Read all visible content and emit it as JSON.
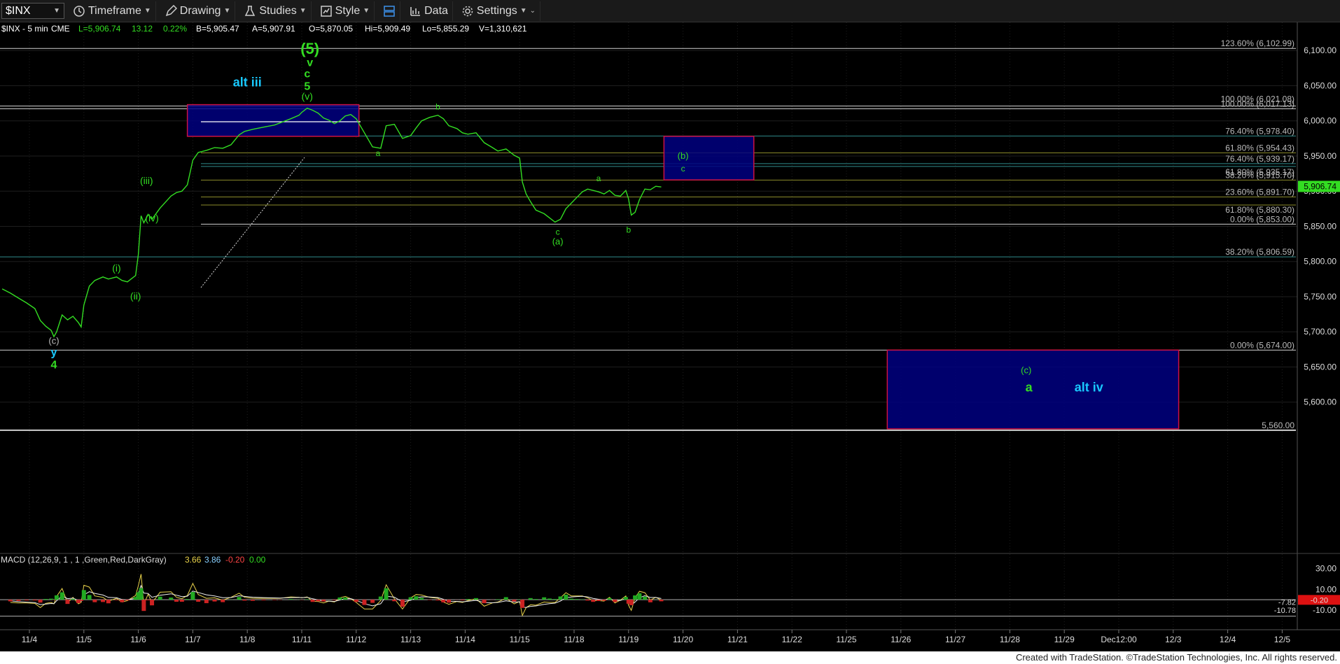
{
  "toolbar": {
    "symbol": "$INX",
    "timeframe": "Timeframe",
    "drawing": "Drawing",
    "studies": "Studies",
    "style": "Style",
    "data": "Data",
    "settings": "Settings"
  },
  "header": {
    "symbol_desc": "$INX - 5 min",
    "exchange": "CME",
    "last": "L=5,906.74",
    "change": "13.12",
    "change_pct": "0.22%",
    "bid": "B=5,905.47",
    "ask": "A=5,907.91",
    "open": "O=5,870.05",
    "high": "Hi=5,909.49",
    "low": "Lo=5,855.29",
    "volume": "V=1,310,621"
  },
  "macd_header": {
    "label": "MACD (12,26,9, 1 , 1 ,Green,Red,DarkGray)",
    "v1": "3.66",
    "v2": "3.86",
    "v3": "-0.20",
    "v4": "0.00"
  },
  "footer": "Created with TradeStation. ©TradeStation Technologies, Inc. All rights reserved.",
  "colors": {
    "price": "#33dd22",
    "label_green": "#33dd22",
    "label_cyan": "#19c9ff",
    "fib_line": "#2f8a8a",
    "box_fill": "#000080",
    "box_border": "#cc1144"
  },
  "chart_data": {
    "type": "line",
    "title": "$INX - 5 min",
    "ylim": [
      5540,
      6140
    ],
    "y_ticks": [
      6100,
      6050,
      6000,
      5950,
      5900,
      5850,
      5800,
      5750,
      5700,
      5650,
      5600
    ],
    "y_tick_labels": [
      "6,100.00",
      "6,050.00",
      "6,000.00",
      "5,950.00",
      "5,900.00",
      "5,850.00",
      "5,800.00",
      "5,750.00",
      "5,700.00",
      "5,650.00",
      "5,600.00"
    ],
    "x_ticks": [
      "11/4",
      "11/5",
      "11/6",
      "11/7",
      "11/8",
      "11/11",
      "11/12",
      "11/13",
      "11/14",
      "11/15",
      "11/18",
      "11/19",
      "11/20",
      "11/21",
      "11/22",
      "11/25",
      "11/26",
      "11/27",
      "11/28",
      "11/29",
      "Dec12:00",
      "12/3",
      "12/4",
      "12/5"
    ],
    "last_price_label": "5,906.74",
    "series": [
      {
        "values": [
          [
            -0.5,
            5761
          ],
          [
            -0.35,
            5755
          ],
          [
            -0.2,
            5748
          ],
          [
            -0.05,
            5741
          ],
          [
            0.1,
            5733
          ],
          [
            0.2,
            5716
          ],
          [
            0.3,
            5708
          ],
          [
            0.4,
            5702
          ],
          [
            0.45,
            5693
          ],
          [
            0.5,
            5700
          ],
          [
            0.6,
            5724
          ],
          [
            0.7,
            5717
          ],
          [
            0.8,
            5722
          ],
          [
            0.9,
            5713
          ],
          [
            0.95,
            5707
          ],
          [
            1.0,
            5738
          ],
          [
            1.1,
            5765
          ],
          [
            1.2,
            5773
          ],
          [
            1.35,
            5778
          ],
          [
            1.45,
            5775
          ],
          [
            1.6,
            5778
          ],
          [
            1.7,
            5773
          ],
          [
            1.8,
            5771
          ],
          [
            1.95,
            5780
          ],
          [
            2.0,
            5810
          ],
          [
            2.05,
            5865
          ],
          [
            2.1,
            5855
          ],
          [
            2.18,
            5867
          ],
          [
            2.25,
            5860
          ],
          [
            2.4,
            5876
          ],
          [
            2.6,
            5893
          ],
          [
            2.7,
            5898
          ],
          [
            2.8,
            5900
          ],
          [
            2.9,
            5909
          ],
          [
            3.0,
            5944
          ],
          [
            3.1,
            5955
          ],
          [
            3.25,
            5958
          ],
          [
            3.4,
            5962
          ],
          [
            3.55,
            5961
          ],
          [
            3.7,
            5966
          ],
          [
            3.85,
            5980
          ],
          [
            3.95,
            5985
          ],
          [
            4.1,
            5988
          ],
          [
            4.3,
            5991
          ],
          [
            4.5,
            5994
          ],
          [
            4.6,
            5997
          ],
          [
            4.8,
            6003
          ],
          [
            4.95,
            6008
          ],
          [
            5.0,
            6012
          ],
          [
            5.1,
            6018
          ],
          [
            5.2,
            6015
          ],
          [
            5.3,
            6011
          ],
          [
            5.4,
            6004
          ],
          [
            5.5,
            6001
          ],
          [
            5.6,
            5996
          ],
          [
            5.7,
            6000
          ],
          [
            5.8,
            6007
          ],
          [
            5.9,
            6009
          ],
          [
            6.0,
            6003
          ],
          [
            6.15,
            5983
          ],
          [
            6.3,
            5963
          ],
          [
            6.45,
            5961
          ],
          [
            6.55,
            5993
          ],
          [
            6.7,
            5995
          ],
          [
            6.85,
            5975
          ],
          [
            7.0,
            5979
          ],
          [
            7.1,
            5990
          ],
          [
            7.2,
            6000
          ],
          [
            7.35,
            6005
          ],
          [
            7.5,
            6008
          ],
          [
            7.6,
            6003
          ],
          [
            7.7,
            5993
          ],
          [
            7.85,
            5989
          ],
          [
            7.95,
            5983
          ],
          [
            8.05,
            5981
          ],
          [
            8.2,
            5983
          ],
          [
            8.35,
            5969
          ],
          [
            8.5,
            5962
          ],
          [
            8.6,
            5957
          ],
          [
            8.75,
            5960
          ],
          [
            8.9,
            5951
          ],
          [
            9.0,
            5947
          ],
          [
            9.05,
            5913
          ],
          [
            9.12,
            5896
          ],
          [
            9.2,
            5885
          ],
          [
            9.3,
            5873
          ],
          [
            9.45,
            5868
          ],
          [
            9.55,
            5862
          ],
          [
            9.65,
            5856
          ],
          [
            9.75,
            5860
          ],
          [
            9.85,
            5875
          ],
          [
            9.95,
            5883
          ],
          [
            10.05,
            5891
          ],
          [
            10.15,
            5899
          ],
          [
            10.25,
            5903
          ],
          [
            10.35,
            5901
          ],
          [
            10.45,
            5899
          ],
          [
            10.55,
            5896
          ],
          [
            10.65,
            5901
          ],
          [
            10.75,
            5894
          ],
          [
            10.85,
            5893
          ],
          [
            10.95,
            5901
          ],
          [
            11.0,
            5889
          ],
          [
            11.05,
            5866
          ],
          [
            11.12,
            5870
          ],
          [
            11.2,
            5888
          ],
          [
            11.3,
            5903
          ],
          [
            11.4,
            5902
          ],
          [
            11.5,
            5907
          ],
          [
            11.6,
            5906
          ]
        ]
      }
    ],
    "fib_levels": [
      {
        "label": "123.60% (6,102.99)",
        "value": 6102.99
      },
      {
        "label": "100.00% (6,021.08)",
        "value": 6021.08
      },
      {
        "label": "100.00% (6,017.13)",
        "value": 6017.13
      },
      {
        "label": "76.40% (5,978.40)",
        "value": 5978.4
      },
      {
        "label": "61.80% (5,954.43)",
        "value": 5954.43
      },
      {
        "label": "76.40% (5,939.17)",
        "value": 5939.17
      },
      {
        "label": "61.80% (5,935.17)",
        "value": 5935.17
      },
      {
        "label": "38.20% (5,915.70)",
        "value": 5915.7
      },
      {
        "label": "23.60% (5,891.70)",
        "value": 5891.7
      },
      {
        "label": "61.80% (5,880.30)",
        "value": 5880.3
      },
      {
        "label": "0.00% (5,853.00)",
        "value": 5853.0
      },
      {
        "label": "38.20% (5,806.59)",
        "value": 5806.59
      },
      {
        "label": "0.00% (5,674.00)",
        "value": 5674.0
      },
      {
        "label": "5,560.00",
        "value": 5560.0
      }
    ],
    "target_boxes": [
      {
        "x0": 2.9,
        "x1": 6.05,
        "y0": 5978,
        "y1": 6023
      },
      {
        "x0": 11.65,
        "x1": 13.3,
        "y0": 5916,
        "y1": 5978
      },
      {
        "x0": 15.75,
        "x1": 21.1,
        "y0": 5562,
        "y1": 5674
      }
    ],
    "wave_labels": [
      {
        "text": "(5)",
        "x": 5.15,
        "y": 6095,
        "size": 22,
        "color": "green"
      },
      {
        "text": "v",
        "x": 5.15,
        "y": 6078,
        "size": 16,
        "color": "green"
      },
      {
        "text": "c",
        "x": 5.1,
        "y": 6062,
        "size": 16,
        "color": "green"
      },
      {
        "text": "5",
        "x": 5.1,
        "y": 6044,
        "size": 16,
        "color": "green"
      },
      {
        "text": "(v)",
        "x": 5.1,
        "y": 6030,
        "size": 14,
        "color": "green"
      },
      {
        "text": "alt iii",
        "x": 4.0,
        "y": 6049,
        "size": 18,
        "color": "cyan"
      },
      {
        "text": "(iii)",
        "x": 2.15,
        "y": 5910,
        "size": 14,
        "color": "green"
      },
      {
        "text": "(iv)",
        "x": 2.25,
        "y": 5857,
        "size": 14,
        "color": "green"
      },
      {
        "text": "(i)",
        "x": 1.6,
        "y": 5786,
        "size": 14,
        "color": "green"
      },
      {
        "text": "(ii)",
        "x": 1.95,
        "y": 5746,
        "size": 14,
        "color": "green"
      },
      {
        "text": "(c)",
        "x": 0.45,
        "y": 5683,
        "size": 13,
        "color": "gray"
      },
      {
        "text": "y",
        "x": 0.45,
        "y": 5666,
        "size": 16,
        "color": "cyan"
      },
      {
        "text": "4",
        "x": 0.45,
        "y": 5648,
        "size": 16,
        "color": "green"
      },
      {
        "text": "a",
        "x": 6.4,
        "y": 5950,
        "size": 12,
        "color": "green"
      },
      {
        "text": "b",
        "x": 7.5,
        "y": 6016,
        "size": 12,
        "color": "green"
      },
      {
        "text": "c",
        "x": 9.7,
        "y": 5838,
        "size": 12,
        "color": "green"
      },
      {
        "text": "(a)",
        "x": 9.7,
        "y": 5824,
        "size": 13,
        "color": "green"
      },
      {
        "text": "a",
        "x": 10.45,
        "y": 5914,
        "size": 12,
        "color": "green"
      },
      {
        "text": "b",
        "x": 11.0,
        "y": 5841,
        "size": 12,
        "color": "green"
      },
      {
        "text": "(b)",
        "x": 12.0,
        "y": 5946,
        "size": 13,
        "color": "green"
      },
      {
        "text": "c",
        "x": 12.0,
        "y": 5928,
        "size": 12,
        "color": "green"
      },
      {
        "text": "(c)",
        "x": 18.3,
        "y": 5641,
        "size": 13,
        "color": "green"
      },
      {
        "text": "a",
        "x": 18.35,
        "y": 5615,
        "size": 18,
        "color": "green"
      },
      {
        "text": "alt iv",
        "x": 19.45,
        "y": 5615,
        "size": 18,
        "color": "cyan"
      }
    ],
    "macd": {
      "ylim": [
        -25,
        42
      ],
      "y_tick_labels": [
        "30.00",
        "10.00",
        "-10.00"
      ],
      "y_ticks": [
        30,
        10,
        -10
      ],
      "last_labels": [
        "-7.82",
        "-0.20",
        "-10.78"
      ]
    }
  }
}
